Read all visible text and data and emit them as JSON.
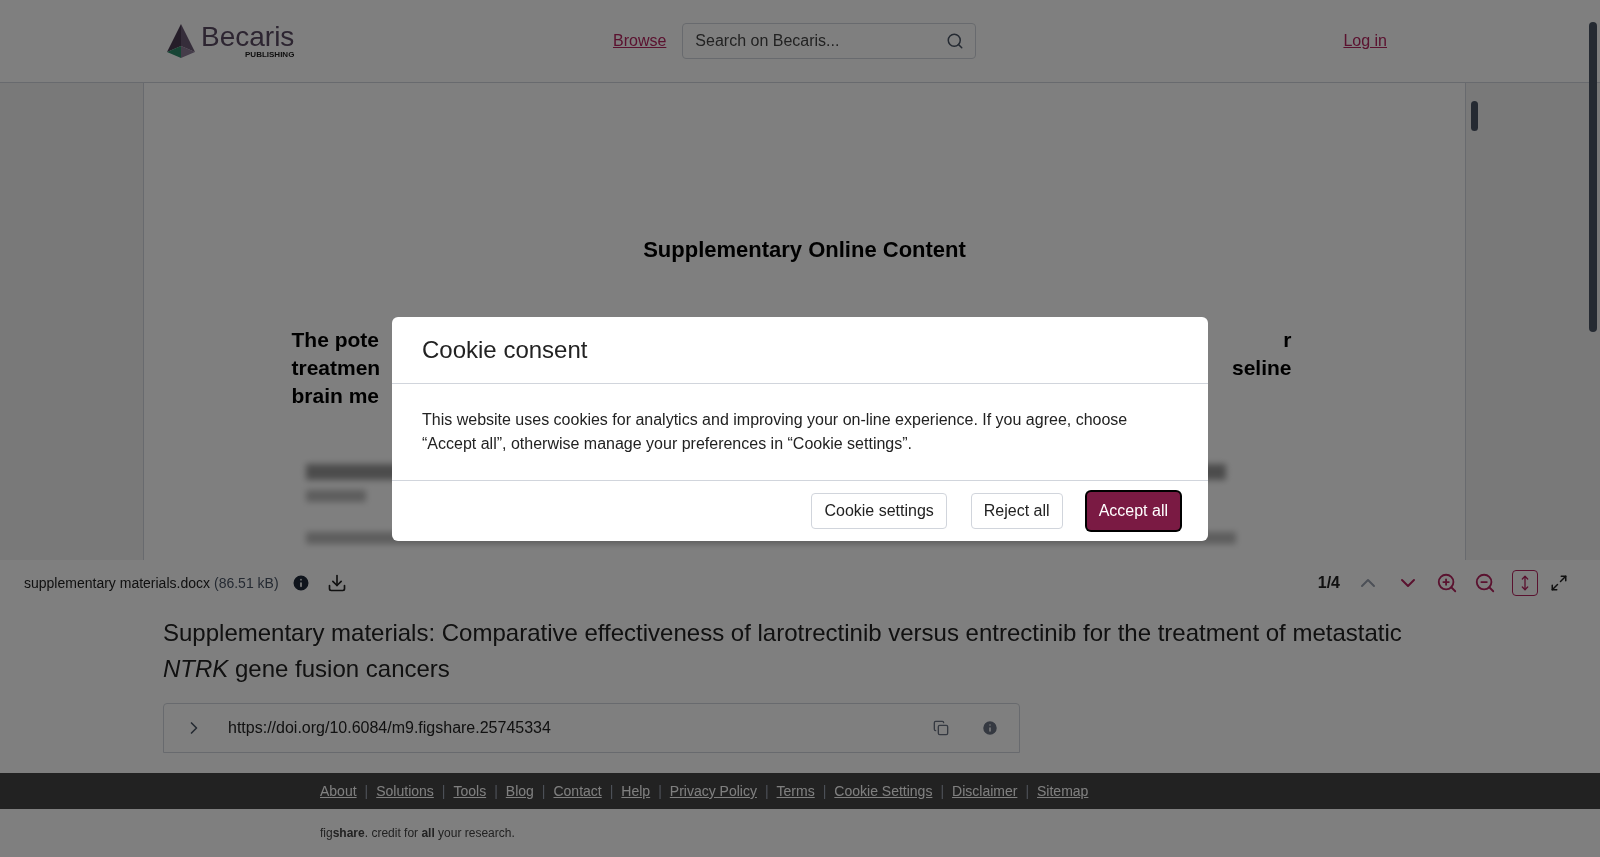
{
  "header": {
    "logo": "Becaris",
    "logo_sub": "PUBLISHING",
    "nav_link": "Browse",
    "search": {
      "placeholder": "Search on Becaris..."
    },
    "login": "Log in"
  },
  "viewer": {
    "doc_title": "Supplementary Online Content",
    "heading_lines": [
      {
        "left": "The pote",
        "right": "r"
      },
      {
        "left": "treatmen",
        "right": "seline"
      },
      {
        "left": "brain me"
      }
    ],
    "toolbar": {
      "filename": "supplementary materials.docx",
      "size": "(86.51 kB)",
      "page": "1/4",
      "fit_selected": true
    }
  },
  "item": {
    "title": "Supplementary materials: Comparative effectiveness of larotrectinib versus entrectinib for the treatment of metastatic *NTRK* gene fusion cancers",
    "doi": "https://doi.org/10.6084/m9.figshare.25745334",
    "expanded": false
  },
  "footer": {
    "separator": "|",
    "links": [
      "About",
      "Solutions",
      "Tools",
      "Blog",
      "Contact",
      "Help",
      "Privacy Policy",
      "Terms",
      "Cookie Settings",
      "Disclaimer",
      "Sitemap"
    ],
    "tagline": "fig**share**. credit for **all** your research."
  },
  "modal": {
    "title": "Cookie consent",
    "body": "This website uses cookies for analytics and improving your on-line experience. If you agree, choose “Accept all”, otherwise manage your preferences in “Cookie settings”.",
    "buttons": [
      {
        "label": "Cookie settings",
        "kind": "secondary"
      },
      {
        "label": "Reject all",
        "kind": "secondary"
      },
      {
        "label": "Accept all",
        "kind": "primary"
      }
    ]
  }
}
